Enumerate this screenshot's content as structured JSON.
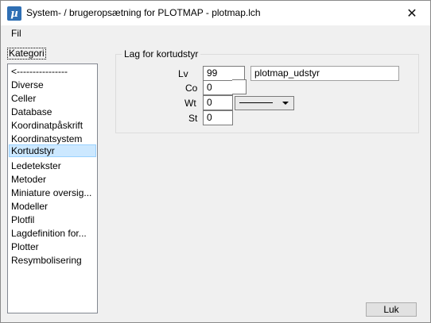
{
  "window": {
    "title": "System- / brugeropsætning for PLOTMAP - plotmap.lch",
    "app_icon": "µ",
    "close_glyph": "✕"
  },
  "menu": {
    "items": [
      "Fil"
    ]
  },
  "category": {
    "label": "Kategori",
    "items": [
      "<----------------",
      "Diverse",
      "Celler",
      "Database",
      "Koordinatpåskrift",
      "Koordinatsystem",
      "Kortudstyr",
      "Ledetekster",
      "Metoder",
      "Miniature oversig...",
      "Modeller",
      "Plotfil",
      "Lagdefinition for...",
      "Plotter",
      "Resymbolisering"
    ],
    "selected": "Kortudstyr"
  },
  "group": {
    "title": "Lag for kortudstyr",
    "lv": {
      "label": "Lv",
      "value": "99",
      "name": "plotmap_udstyr"
    },
    "co": {
      "label": "Co",
      "value": "0"
    },
    "wt": {
      "label": "Wt",
      "value": "0"
    },
    "st": {
      "label": "St",
      "value": "0"
    }
  },
  "buttons": {
    "ok": "Luk"
  },
  "colors": {
    "selection": "#cce8ff",
    "selection_border": "#99d1ff"
  }
}
